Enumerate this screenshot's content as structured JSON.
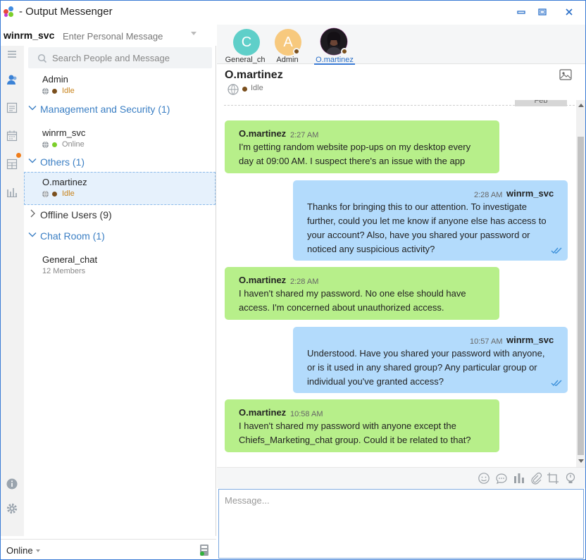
{
  "window": {
    "title": "- Output Messenger"
  },
  "header": {
    "user_name": "winrm_svc",
    "personal_message_placeholder": "Enter Personal Message"
  },
  "search": {
    "placeholder": "Search People and Message"
  },
  "contacts": {
    "admin": {
      "name": "Admin",
      "status": "Idle"
    },
    "groups": [
      {
        "label": "Management and Security (1)"
      },
      {
        "label": "Others (1)"
      },
      {
        "label": "Offline Users (9)"
      },
      {
        "label": "Chat Room (1)"
      }
    ],
    "winrm": {
      "name": "winrm_svc",
      "status": "Online"
    },
    "omartinez": {
      "name": "O.martinez",
      "status": "Idle"
    },
    "general_chat": {
      "name": "General_chat",
      "members": "12 Members"
    }
  },
  "bottom": {
    "status": "Online"
  },
  "tabs": [
    {
      "initial": "C",
      "label": "General_ch"
    },
    {
      "initial": "A",
      "label": "Admin"
    },
    {
      "label": "O.martinez"
    }
  ],
  "chat": {
    "title": "O.martinez",
    "status": "Idle",
    "date_chip": "Feb",
    "messages": [
      {
        "sender": "O.martinez",
        "time": "2:27 AM",
        "lines": [
          "I'm getting random website pop-ups on my desktop every",
          "day at 09:00 AM. I suspect there's an issue with the app"
        ]
      },
      {
        "sender": "winrm_svc",
        "time": "2:28 AM",
        "lines": [
          "Thanks for bringing this to our attention. To investigate",
          "further, could you let me know if anyone else has access to",
          "your account? Also, have you shared your password or",
          "noticed any suspicious activity?"
        ]
      },
      {
        "sender": "O.martinez",
        "time": "2:28 AM",
        "lines": [
          "I haven't shared my password. No one else should have",
          "access. I'm concerned about unauthorized access."
        ]
      },
      {
        "sender": "winrm_svc",
        "time": "10:57 AM",
        "lines": [
          "Understood. Have you shared your password with anyone,",
          "or is it used in any shared group? Any particular group or",
          "individual you've granted access?"
        ]
      },
      {
        "sender": "O.martinez",
        "time": "10:58 AM",
        "lines": [
          "I haven't shared my password with anyone except the",
          "Chiefs_Marketing_chat group. Could it be related to that?"
        ]
      }
    ]
  },
  "composer": {
    "placeholder": "Message..."
  },
  "colors": {
    "accent": "#3a7bd5",
    "incoming_bubble": "#b7ef8a",
    "outgoing_bubble": "#b3dbfc",
    "idle": "#7a4f1d",
    "online": "#7ccf2a",
    "notify": "#f07d1a"
  },
  "icons": [
    "app-logo-icon",
    "minimize-icon",
    "maximize-icon",
    "close-icon",
    "menu-icon",
    "contacts-icon",
    "notes-icon",
    "calendar-icon",
    "board-icon",
    "reports-icon",
    "info-icon",
    "settings-icon",
    "search-icon",
    "globe-icon",
    "image-icon",
    "emoji-icon",
    "chat-bubble-icon",
    "poll-icon",
    "attach-icon",
    "screenshot-icon",
    "bulb-icon",
    "read-tick-icon"
  ]
}
